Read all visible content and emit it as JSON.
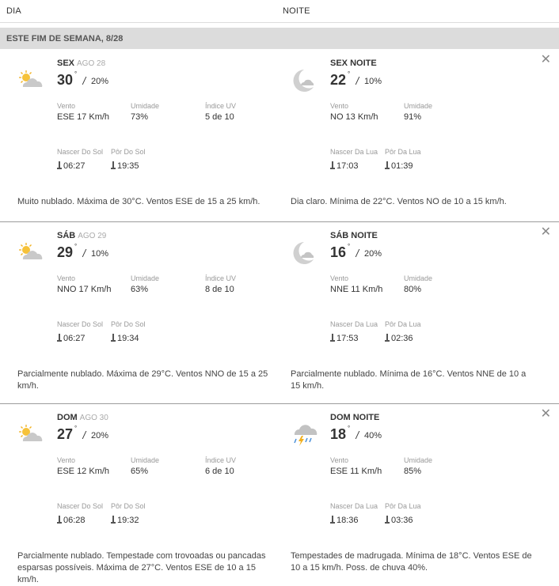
{
  "header": {
    "day_col": "DIA",
    "night_col": "NOITE"
  },
  "weekend_label": "ESTE FIM DE SEMANA, 8/28",
  "labels": {
    "wind": "Vento",
    "humidity": "Umidade",
    "uv": "Índice UV",
    "sunrise": "Nascer Do Sol",
    "sunset": "Pôr Do Sol",
    "moonrise": "Nascer Da Lua",
    "moonset": "Pôr Da Lua"
  },
  "days": [
    {
      "day": {
        "name": "SEX",
        "date": "AGO 28",
        "icon": "partly-cloudy-sun-icon",
        "temp": "30",
        "precip": "20%",
        "wind": "ESE 17 Km/h",
        "humidity": "73%",
        "uv": "5 de 10",
        "sunrise": "06:27",
        "sunset": "19:35",
        "desc": "Muito nublado. Máxima de 30°C. Ventos ESE de 15 a 25 km/h."
      },
      "night": {
        "name": "SEX NOITE",
        "icon": "moon-cloud-icon",
        "temp": "22",
        "precip": "10%",
        "wind": "NO 13 Km/h",
        "humidity": "91%",
        "moonrise": "17:03",
        "moonset": "01:39",
        "desc": "Dia claro. Mínima de 22°C. Ventos NO de 10 a 15 km/h."
      }
    },
    {
      "day": {
        "name": "SÁB",
        "date": "AGO 29",
        "icon": "partly-cloudy-sun-icon",
        "temp": "29",
        "precip": "10%",
        "wind": "NNO 17 Km/h",
        "humidity": "63%",
        "uv": "8 de 10",
        "sunrise": "06:27",
        "sunset": "19:34",
        "desc": "Parcialmente nublado. Máxima de 29°C. Ventos NNO de 15 a 25 km/h."
      },
      "night": {
        "name": "SÁB NOITE",
        "icon": "moon-cloud-icon",
        "temp": "16",
        "precip": "20%",
        "wind": "NNE 11 Km/h",
        "humidity": "80%",
        "moonrise": "17:53",
        "moonset": "02:36",
        "desc": "Parcialmente nublado. Mínima de 16°C. Ventos NNE de 10 a 15 km/h."
      }
    },
    {
      "day": {
        "name": "DOM",
        "date": "AGO 30",
        "icon": "partly-cloudy-sun-icon",
        "temp": "27",
        "precip": "20%",
        "wind": "ESE 12 Km/h",
        "humidity": "65%",
        "uv": "6 de 10",
        "sunrise": "06:28",
        "sunset": "19:32",
        "desc": "Parcialmente nublado. Tempestade com trovoadas ou pancadas esparsas possíveis. Máxima de 27°C. Ventos ESE de 10 a 15 km/h."
      },
      "night": {
        "name": "DOM NOITE",
        "icon": "thunderstorm-icon",
        "temp": "18",
        "precip": "40%",
        "wind": "ESE 11 Km/h",
        "humidity": "85%",
        "moonrise": "18:36",
        "moonset": "03:36",
        "desc": "Tempestades de madrugada. Mínima de 18°C. Ventos ESE de 10 a 15 km/h. Poss. de chuva 40%."
      }
    }
  ]
}
